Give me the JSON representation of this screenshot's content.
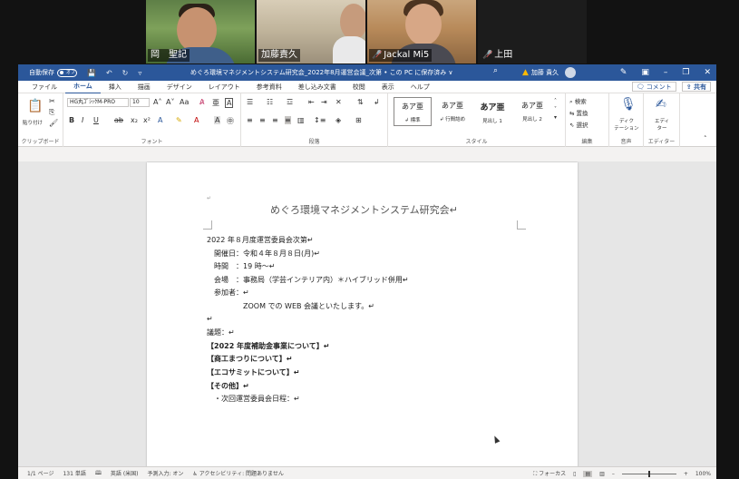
{
  "participants": [
    {
      "name": "岡　聖記",
      "muted": false
    },
    {
      "name": "加藤責久",
      "muted": false
    },
    {
      "name": "Jackal Mi5",
      "muted": true
    },
    {
      "name": "上田",
      "muted": true
    }
  ],
  "titlebar": {
    "autosave_label": "自動保存",
    "autosave_state": "オフ",
    "doc_title": "めぐろ環境マネジメントシステム研究会_2022年8月運営会議_次第 • この PC に保存済み ∨",
    "warn_user": "加藤 貴久"
  },
  "menu": {
    "tabs": [
      "ファイル",
      "ホーム",
      "挿入",
      "描画",
      "デザイン",
      "レイアウト",
      "参考資料",
      "差し込み文書",
      "校閲",
      "表示",
      "ヘルプ"
    ],
    "active": "ホーム",
    "comment_label": "コメント",
    "share_label": "共有"
  },
  "ribbon": {
    "clipboard": {
      "paste_label": "貼り付け",
      "group_label": "クリップボード"
    },
    "font": {
      "font_name": "HG丸ｺﾞｼｯｸM-PRO",
      "font_size": "10",
      "group_label": "フォント"
    },
    "paragraph": {
      "group_label": "段落"
    },
    "styles": {
      "items": [
        {
          "sample": "あア亜",
          "name": "↲ 標準"
        },
        {
          "sample": "あア亜",
          "name": "↲ 行間詰め"
        },
        {
          "sample": "あア亜",
          "name": "見出し 1"
        },
        {
          "sample": "あア亜",
          "name": "見出し 2"
        }
      ],
      "group_label": "スタイル"
    },
    "editing": {
      "find": "検索",
      "replace": "置換",
      "select": "選択",
      "group_label": "編集"
    },
    "voice": {
      "dictate": "ディク\nテーション",
      "group_label": "音声"
    },
    "editor": {
      "label": "エディ\nター",
      "group_label": "エディター"
    }
  },
  "document": {
    "heading": "めぐろ環境マネジメントシステム研究会↵",
    "lines": [
      {
        "text": "2022 年８月度運営委員会次第↵",
        "bold": false,
        "indent": 0
      },
      {
        "text": "開催日：令和４年８月８日(月)↵",
        "bold": false,
        "indent": 8
      },
      {
        "text": "時間　：19 時〜↵",
        "bold": false,
        "indent": 8
      },
      {
        "text": "会場　：事務局（学芸インテリア内）＊ハイブリッド併用↵",
        "bold": false,
        "indent": 8
      },
      {
        "text": "参加者：↵",
        "bold": false,
        "indent": 8
      },
      {
        "text": "ZOOM での WEB 会議といたします。↵",
        "bold": false,
        "indent": 40
      },
      {
        "text": "↵",
        "bold": false,
        "indent": 0
      },
      {
        "text": "議題：↵",
        "bold": false,
        "indent": 0
      },
      {
        "text": "【2022 年度補助金事業について】↵",
        "bold": true,
        "indent": 0
      },
      {
        "text": "【商工まつりについて】↵",
        "bold": true,
        "indent": 0
      },
      {
        "text": "【エコサミットについて】↵",
        "bold": true,
        "indent": 0
      },
      {
        "text": "【その他】↵",
        "bold": true,
        "indent": 0
      },
      {
        "text": "・次回運営委員会日程：↵",
        "bold": false,
        "indent": 8
      }
    ]
  },
  "statusbar": {
    "page": "1/1 ページ",
    "words": "131 単語",
    "language": "英語 (米国)",
    "predict": "予測入力: オン",
    "accessibility": "アクセシビリティ: 問題ありません",
    "focus": "フォーカス",
    "zoom": "100%",
    "zoom_fraction": 0.5
  }
}
